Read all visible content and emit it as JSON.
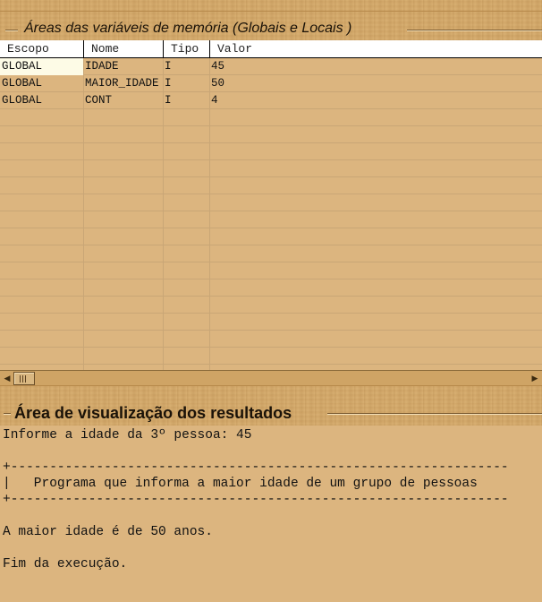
{
  "memory_panel": {
    "title": "Áreas das variáveis de memória (Globais e Locais )",
    "columns": [
      "Escopo",
      "Nome",
      "Tipo",
      "Valor"
    ],
    "rows": [
      {
        "escopo": "GLOBAL",
        "nome": "IDADE",
        "tipo": "I",
        "valor": "45"
      },
      {
        "escopo": "GLOBAL",
        "nome": "MAIOR_IDADE",
        "tipo": "I",
        "valor": "50"
      },
      {
        "escopo": "GLOBAL",
        "nome": "CONT",
        "tipo": "I",
        "valor": "4"
      }
    ]
  },
  "results_panel": {
    "title": "Área de visualização dos resultados",
    "lines": [
      "Informe a idade da 3º pessoa: 45",
      "",
      "+----------------------------------------------------------------",
      "|   Programa que informa a maior idade de um grupo de pessoas",
      "+----------------------------------------------------------------",
      "",
      "A maior idade é de 50 anos.",
      "",
      "Fim da execução."
    ]
  },
  "colors": {
    "panel_bg": "#dcb57f",
    "wood": "#d4a96a",
    "selected_cell": "#fdfbe6",
    "text": "#111111"
  },
  "icons": {
    "scroll_left": "triangle-left",
    "scroll_right": "triangle-right"
  }
}
